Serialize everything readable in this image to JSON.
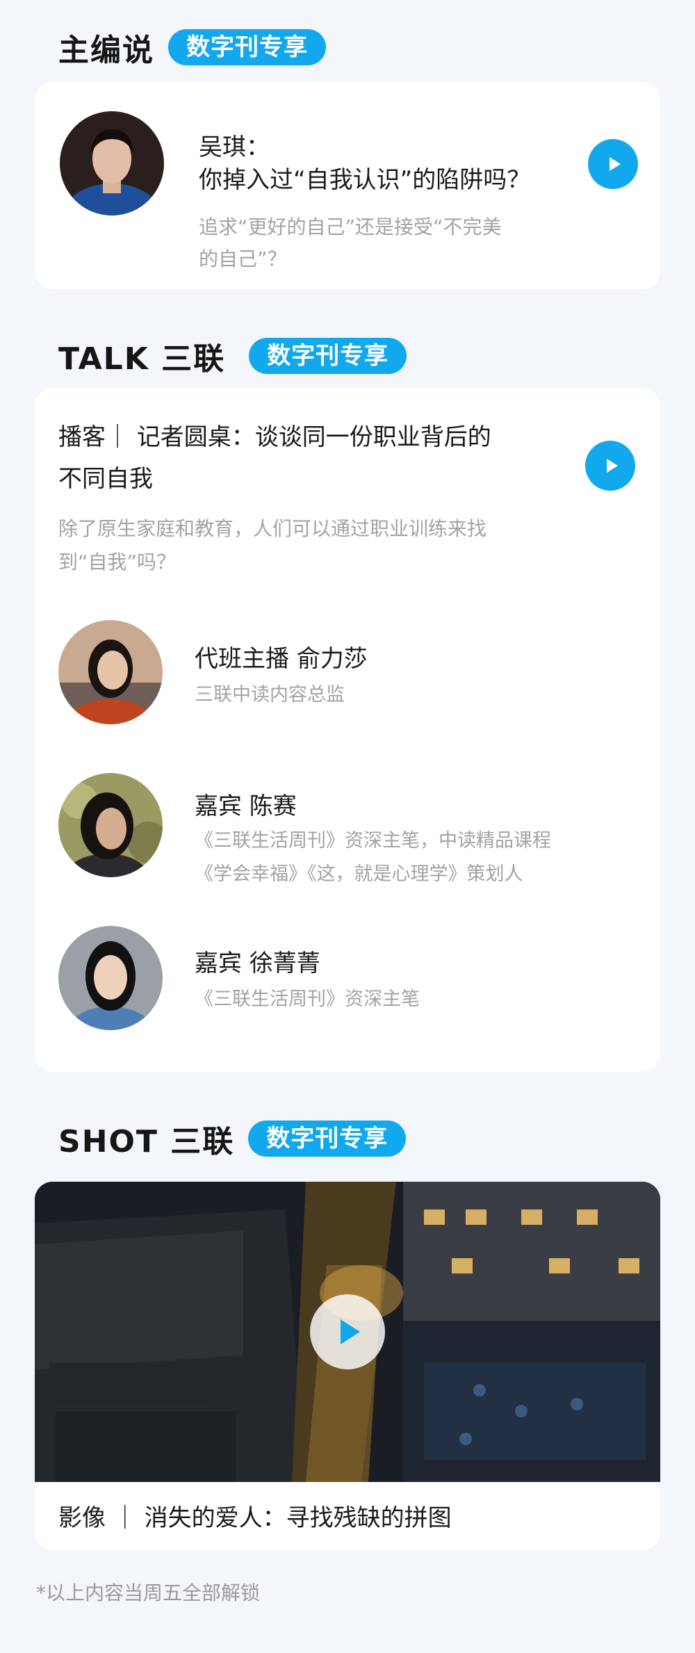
{
  "editor_section": {
    "title": "主编说",
    "badge": "数字刊专享",
    "name": "吴琪：",
    "headline": "你掉入过“自我认识”的陷阱吗？",
    "subtitle_line1": "追求“更好的自己”还是接受“不完美",
    "subtitle_line2": "的自己”？",
    "play_icon": "play-icon"
  },
  "talk_section": {
    "title": "TALK 三联",
    "badge": "数字刊专享",
    "headline_line1": "播客｜ 记者圆桌：谈谈同一份职业背后的",
    "headline_line2": "不同自我",
    "subtitle_line1": "除了原生家庭和教育，人们可以通过职业训练来找",
    "subtitle_line2": "到“自我”吗？",
    "guests": [
      {
        "name": "代班主播 俞力莎",
        "desc_line1": "三联中读内容总监",
        "desc_line2": ""
      },
      {
        "name": "嘉宾 陈赛",
        "desc_line1": "《三联生活周刊》资深主笔，中读精品课程",
        "desc_line2": "《学会幸福》《这，就是心理学》策划人"
      },
      {
        "name": "嘉宾 徐菁菁",
        "desc_line1": "《三联生活周刊》资深主笔",
        "desc_line2": ""
      }
    ]
  },
  "shot_section": {
    "title": "SHOT 三联",
    "badge": "数字刊专享",
    "caption": "影像 ｜ 消失的爱人：寻找残缺的拼图"
  },
  "footnote": "*以上内容当周五全部解锁",
  "colors": {
    "accent": "#12a8ee",
    "background": "#f3f6fb",
    "muted_text": "#a3a3a3"
  }
}
